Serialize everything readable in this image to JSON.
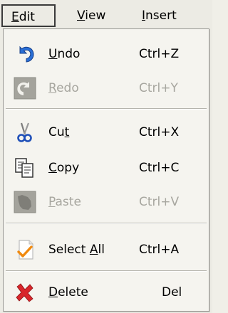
{
  "menubar": {
    "items": [
      {
        "label": "Edit",
        "mnemonic": "E",
        "rest": "dit"
      },
      {
        "label": "View",
        "mnemonic": "V",
        "rest": "iew"
      },
      {
        "label": "Insert",
        "mnemonic": "I",
        "rest": "nsert"
      }
    ]
  },
  "menu": {
    "items": [
      {
        "label": "Undo",
        "mnemonic": "U",
        "rest": "ndo",
        "shortcut": "Ctrl+Z",
        "enabled": true,
        "icon": "undo-icon"
      },
      {
        "label": "Redo",
        "mnemonic": "R",
        "rest": "edo",
        "shortcut": "Ctrl+Y",
        "enabled": false,
        "icon": "redo-icon"
      },
      {
        "label": "Cut",
        "pre": "Cu",
        "mnemonic": "t",
        "shortcut": "Ctrl+X",
        "enabled": true,
        "icon": "scissors-icon"
      },
      {
        "label": "Copy",
        "mnemonic": "C",
        "rest": "opy",
        "shortcut": "Ctrl+C",
        "enabled": true,
        "icon": "copy-icon"
      },
      {
        "label": "Paste",
        "mnemonic": "P",
        "rest": "aste",
        "shortcut": "Ctrl+V",
        "enabled": false,
        "icon": "paste-icon"
      },
      {
        "label": "Select All",
        "pre": "Select ",
        "mnemonic": "A",
        "rest": "ll",
        "shortcut": "Ctrl+A",
        "enabled": true,
        "icon": "select-all-icon"
      },
      {
        "label": "Delete",
        "mnemonic": "D",
        "rest": "elete",
        "shortcut": "Del",
        "enabled": true,
        "icon": "delete-icon"
      }
    ]
  },
  "colors": {
    "undo_blue": "#2a6fd6",
    "disabled_gray": "#a7a69f",
    "delete_red": "#d8262b",
    "check_orange": "#f08a10"
  }
}
